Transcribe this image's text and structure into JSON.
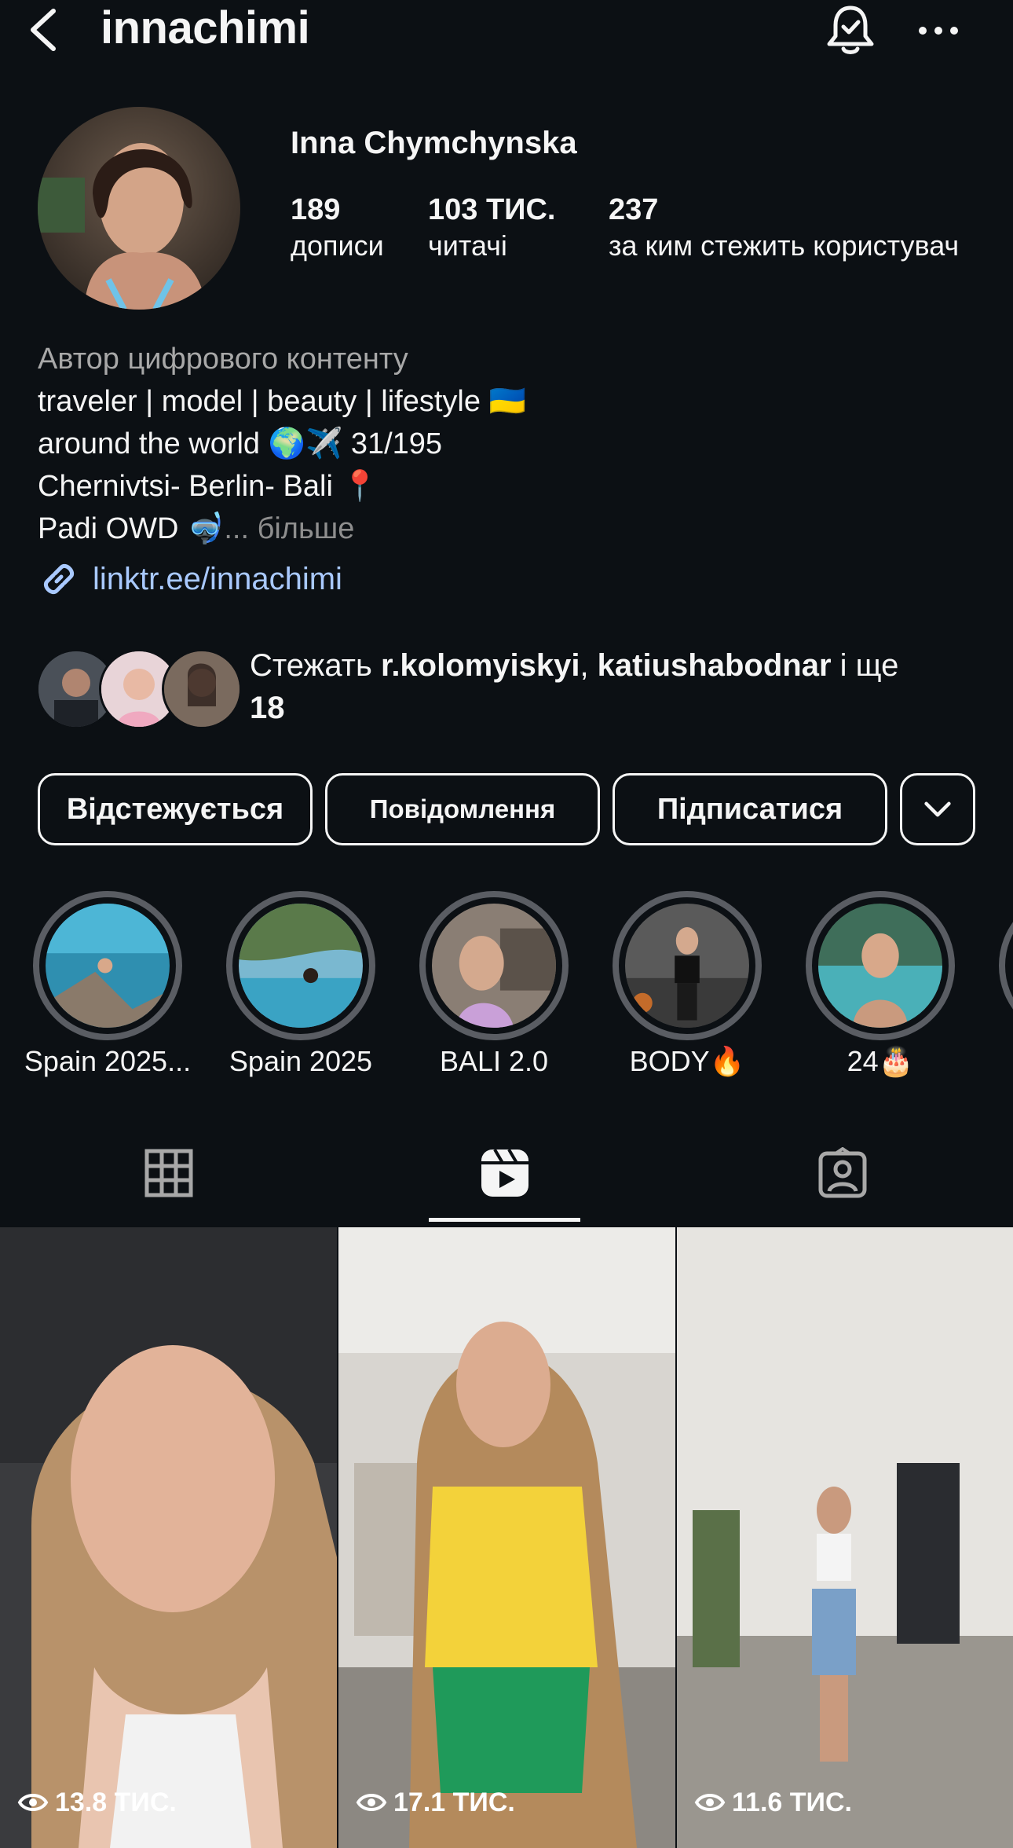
{
  "header": {
    "username": "innachimi"
  },
  "profile": {
    "full_name": "Inna Chymchynska",
    "stats": [
      {
        "value": "189",
        "label": "дописи"
      },
      {
        "value": "103 ТИС.",
        "label": "читачі"
      },
      {
        "value": "237",
        "label": "за ким стежить користувач"
      }
    ]
  },
  "bio": {
    "category": "Автор цифрового контенту",
    "line1": "traveler | model | beauty | lifestyle 🇺🇦",
    "line2": "around the world 🌍✈️ 31/195",
    "line3": "Chernivtsi- Berlin- Bali 📍",
    "line4": "Padi OWD 🤿",
    "more": "... більше",
    "link": "linktr.ee/innachimi"
  },
  "followed_by": {
    "prefix": "Стежать ",
    "user1": "r.kolomyiskyi",
    "sep": ", ",
    "user2": "katiushabodnar",
    "suffix_and": " і ще ",
    "count": "18"
  },
  "buttons": {
    "following": "Відстежується",
    "message": "Повідомлення",
    "subscribe": "Підписатися"
  },
  "highlights": [
    {
      "label": "Spain 2025..."
    },
    {
      "label": "Spain 2025"
    },
    {
      "label": "BALI 2.0"
    },
    {
      "label": "BODY🔥"
    },
    {
      "label": "24🎂"
    }
  ],
  "tabs": {
    "active": "reels"
  },
  "reels": [
    {
      "views": "13.8 ТИС."
    },
    {
      "views": "17.1 ТИС."
    },
    {
      "views": "11.6 ТИС."
    }
  ],
  "colors": {
    "background": "#0c1014",
    "link": "#a9c9ff",
    "secondary_text": "#a8a8a8"
  }
}
